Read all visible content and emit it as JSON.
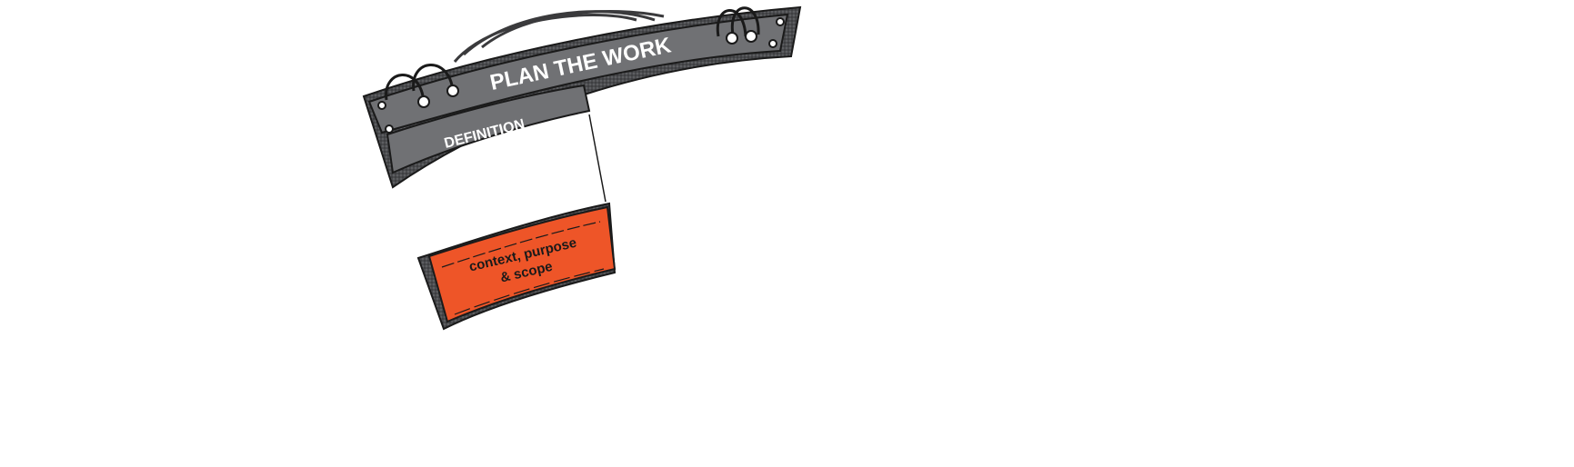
{
  "banner": {
    "title": "PLAN THE WORK"
  },
  "section": {
    "label": "DEFINITION"
  },
  "card": {
    "line1": "context, purpose",
    "line2": "& scope"
  },
  "colors": {
    "banner_gray": "#707174",
    "banner_dark": "#4a4b4e",
    "card_orange": "#ee5528",
    "outline": "#1a1a1a",
    "shadow": "#3c3c3f"
  }
}
